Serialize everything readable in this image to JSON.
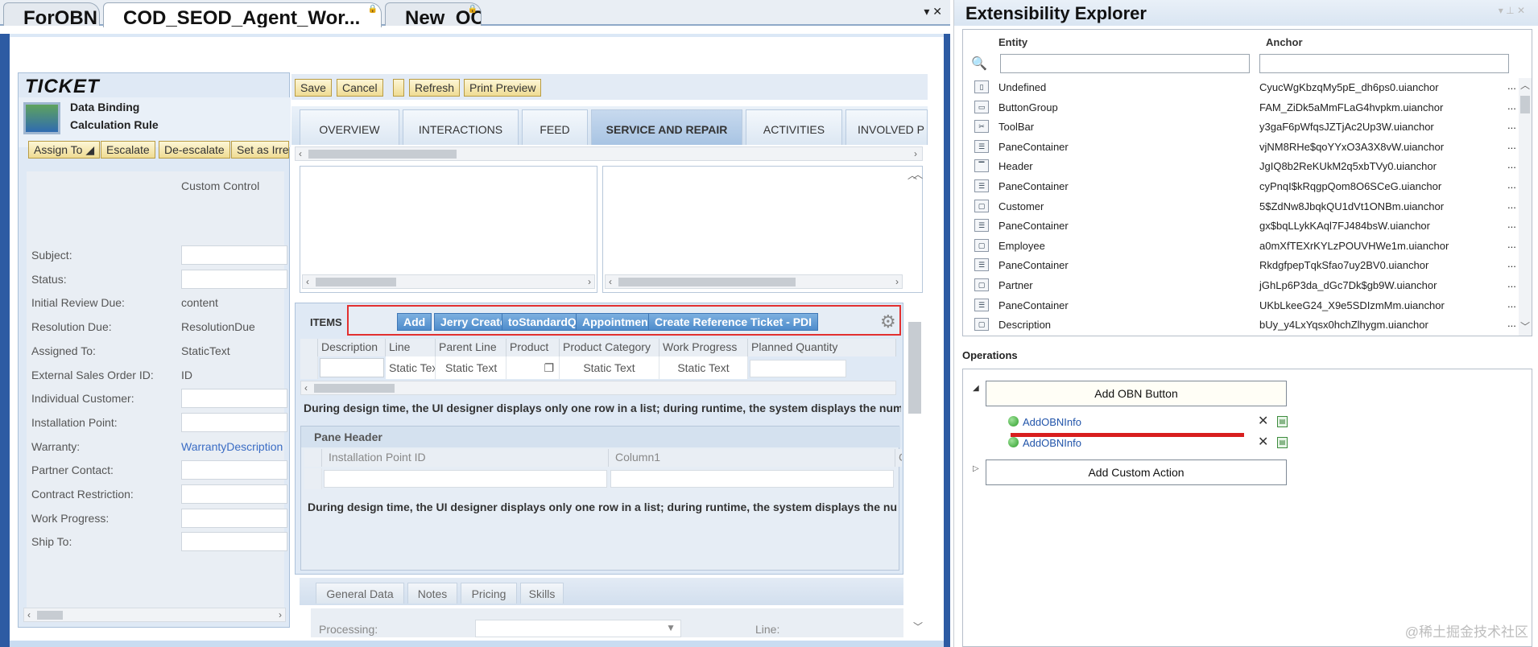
{
  "doc_tabs": [
    {
      "label": "ForOBN"
    },
    {
      "label": "COD_SEOD_Agent_Wor..."
    },
    {
      "label": "New_OC"
    }
  ],
  "tab_controls": "▾ ✕",
  "ticket": {
    "title": "TICKET",
    "binding": "Data Binding",
    "calc_rule": "Calculation Rule",
    "buttons": [
      "Assign To ◢",
      "Escalate",
      "De-escalate",
      "Set as Irre"
    ],
    "custom_control": "Custom Control",
    "fields": [
      {
        "label": "Subject:",
        "value": "",
        "kind": "box"
      },
      {
        "label": "Status:",
        "value": "",
        "kind": "box"
      },
      {
        "label": "Initial Review Due:",
        "value": "content",
        "kind": "text"
      },
      {
        "label": "Resolution Due:",
        "value": "ResolutionDue",
        "kind": "text"
      },
      {
        "label": "Assigned To:",
        "value": "StaticText",
        "kind": "text"
      },
      {
        "label": "External Sales Order ID:",
        "value": "ID",
        "kind": "text"
      },
      {
        "label": "Individual Customer:",
        "value": "",
        "kind": "box"
      },
      {
        "label": "Installation Point:",
        "value": "",
        "kind": "box"
      },
      {
        "label": "Warranty:",
        "value": "WarrantyDescription",
        "kind": "link"
      },
      {
        "label": "Partner Contact:",
        "value": "",
        "kind": "box"
      },
      {
        "label": "Contract Restriction:",
        "value": "",
        "kind": "box"
      },
      {
        "label": "Work Progress:",
        "value": "",
        "kind": "box"
      },
      {
        "label": "Ship To:",
        "value": "",
        "kind": "box"
      }
    ]
  },
  "main_toolbar": [
    "Save",
    "Cancel",
    "",
    "Refresh",
    "Print Preview"
  ],
  "nav_tabs": [
    {
      "label": "OVERVIEW",
      "active": false
    },
    {
      "label": "INTERACTIONS",
      "active": false
    },
    {
      "label": "FEED",
      "active": false
    },
    {
      "label": "SERVICE AND REPAIR",
      "active": true
    },
    {
      "label": "ACTIVITIES",
      "active": false
    },
    {
      "label": "INVOLVED P",
      "active": false
    }
  ],
  "items": {
    "label": "ITEMS",
    "buttons": [
      "Add",
      "Jerry Create",
      "toStandardQC",
      "Appointment",
      "Create Reference Ticket - PDI"
    ],
    "columns": [
      "Description",
      "Line",
      "Parent Line",
      "Product",
      "Product Category",
      "Work Progress",
      "Planned Quantity"
    ],
    "row": [
      "",
      "Static Text",
      "Static Text",
      "",
      "Static Text",
      "Static Text",
      ""
    ],
    "note": "During design time, the UI designer displays only one row in a list; during runtime, the system displays the numb"
  },
  "pane": {
    "header": "Pane Header",
    "columns": [
      "Installation Point ID",
      "Column1",
      "C"
    ],
    "note": "During design time, the UI designer displays only one row in a list; during runtime, the system displays the numb"
  },
  "sub_tabs": [
    "General Data",
    "Notes",
    "Pricing",
    "Skills"
  ],
  "bottom_fields": [
    "Processing:",
    "Line:"
  ],
  "explorer": {
    "title": "Extensibility Explorer",
    "title_controls": "▾ ⊥ ✕",
    "col_entity": "Entity",
    "col_anchor": "Anchor",
    "rows": [
      {
        "entity": "Undefined",
        "anchor": "CyucWgKbzqMy5pE_dh6ps0.uianchor",
        "icon": "page-icon"
      },
      {
        "entity": "ButtonGroup",
        "anchor": "FAM_ZiDk5aMmFLaG4hvpkm.uianchor",
        "icon": "button-group-icon"
      },
      {
        "entity": "ToolBar",
        "anchor": "y3gaF6pWfqsJZTjAc2Up3W.uianchor",
        "icon": "toolbar-icon"
      },
      {
        "entity": "PaneContainer",
        "anchor": "vjNM8RHe$qoYYxO3A3X8vW.uianchor",
        "icon": "pane-container-icon"
      },
      {
        "entity": "Header",
        "anchor": "JgIQ8b2ReKUkM2q5xbTVy0.uianchor",
        "icon": "header-icon"
      },
      {
        "entity": "PaneContainer",
        "anchor": "cyPnqI$kRqgpQom8O6SCeG.uianchor",
        "icon": "pane-container-icon"
      },
      {
        "entity": "Customer",
        "anchor": "5$ZdNw8JbqkQU1dVt1ONBm.uianchor",
        "icon": "window-icon"
      },
      {
        "entity": "PaneContainer",
        "anchor": "gx$bqLLykKAql7FJ484bsW.uianchor",
        "icon": "pane-container-icon"
      },
      {
        "entity": "Employee",
        "anchor": "a0mXfTEXrKYLzPOUVHWe1m.uianchor",
        "icon": "window-icon"
      },
      {
        "entity": "PaneContainer",
        "anchor": "RkdgfpepTqkSfao7uy2BV0.uianchor",
        "icon": "pane-container-icon"
      },
      {
        "entity": "Partner",
        "anchor": "jGhLp6P3da_dGc7Dk$gb9W.uianchor",
        "icon": "window-icon"
      },
      {
        "entity": "PaneContainer",
        "anchor": "UKbLkeeG24_X9e5SDIzmMm.uianchor",
        "icon": "pane-container-icon"
      },
      {
        "entity": "Description",
        "anchor": "bUy_y4LxYqsx0hchZlhygm.uianchor",
        "icon": "window-icon"
      }
    ],
    "operations_label": "Operations",
    "add_obn_button": "Add OBN Button",
    "obn_items": [
      "AddOBNInfo",
      "AddOBNInfo"
    ],
    "add_custom_action": "Add Custom Action"
  },
  "watermark": "@稀土掘金技术社区"
}
